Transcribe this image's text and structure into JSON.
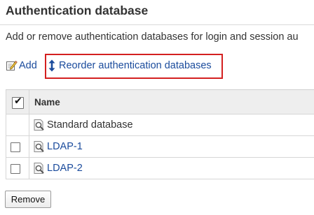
{
  "page": {
    "title": "Authentication database",
    "description": "Add or remove authentication databases for login and session au"
  },
  "toolbar": {
    "add_label": "Add",
    "reorder_label": "Reorder authentication databases",
    "highlight_color": "#d42020"
  },
  "table": {
    "select_all_checked": true,
    "columns": [
      "Name"
    ],
    "rows": [
      {
        "name": "Standard database",
        "has_checkbox": false,
        "is_link": false
      },
      {
        "name": "LDAP-1",
        "has_checkbox": true,
        "is_link": true
      },
      {
        "name": "LDAP-2",
        "has_checkbox": true,
        "is_link": true
      }
    ]
  },
  "actions": {
    "remove_label": "Remove"
  },
  "icons": {
    "add": "edit-icon",
    "reorder": "up-down-arrow-icon",
    "database": "database-search-icon"
  },
  "colors": {
    "link": "#1a4b9c",
    "header_bg": "#eeeeee"
  }
}
